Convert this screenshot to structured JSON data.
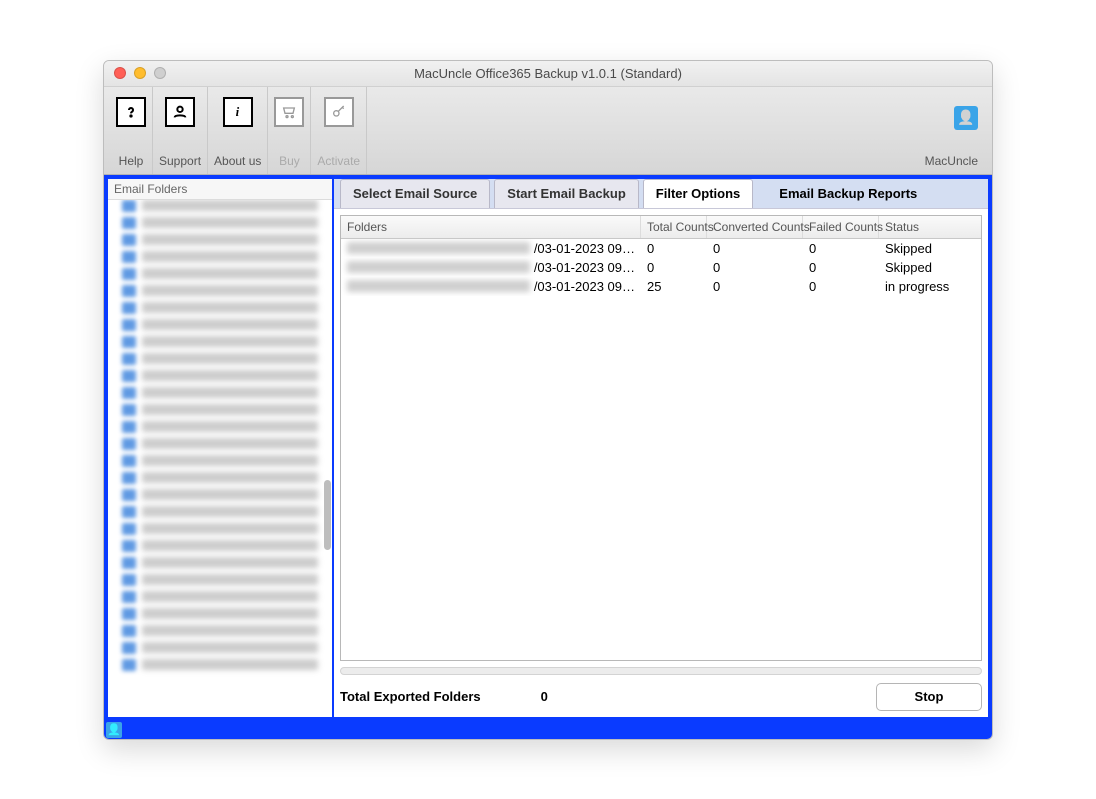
{
  "window": {
    "title": "MacUncle Office365 Backup v1.0.1 (Standard)"
  },
  "toolbar": {
    "help": "Help",
    "support": "Support",
    "aboutus": "About us",
    "buy": "Buy",
    "activate": "Activate",
    "brand": "MacUncle"
  },
  "left": {
    "header": "Email Folders"
  },
  "tabs": {
    "t0": "Select Email Source",
    "t1": "Start Email Backup",
    "t2": "Filter Options",
    "t3": "Email Backup Reports"
  },
  "table": {
    "headers": {
      "folders": "Folders",
      "total": "Total Counts",
      "converted": "Converted Counts",
      "failed": "Failed Counts",
      "status": "Status"
    },
    "rows": [
      {
        "date": "/03-01-2023 09…",
        "total": "0",
        "converted": "0",
        "failed": "0",
        "status": "Skipped"
      },
      {
        "date": "/03-01-2023 09…",
        "total": "0",
        "converted": "0",
        "failed": "0",
        "status": "Skipped"
      },
      {
        "date": "/03-01-2023 09…",
        "total": "25",
        "converted": "0",
        "failed": "0",
        "status": "in progress"
      }
    ]
  },
  "footer": {
    "label": "Total Exported Folders",
    "value": "0",
    "stop": "Stop"
  }
}
